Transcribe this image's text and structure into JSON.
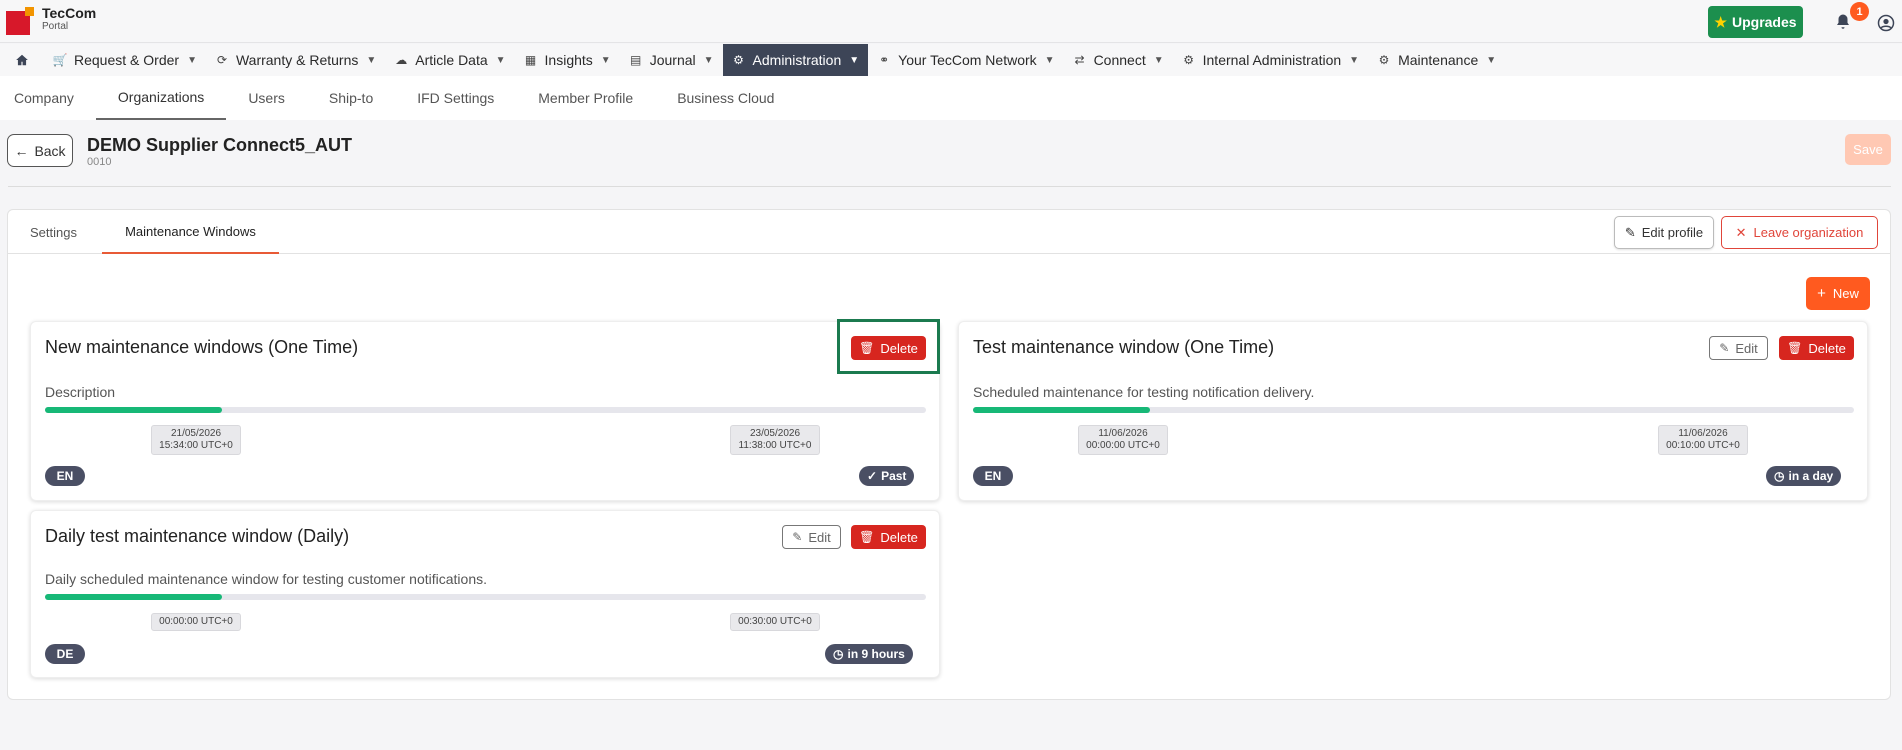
{
  "app": {
    "logo_title": "TecCom",
    "logo_subtitle": "Portal",
    "upgrades_label": "Upgrades",
    "notification_count": "1"
  },
  "colors": {
    "brand_red": "#d7182a",
    "brand_orange": "#f29400",
    "accent": "#ff5a1f",
    "active_nav": "#3d4557",
    "upgrades_green": "#1c8f4e",
    "danger": "#d7261f",
    "progress": "#17b877"
  },
  "main_nav": [
    {
      "label": "Request & Order",
      "icon": "cart-icon"
    },
    {
      "label": "Warranty & Returns",
      "icon": "refresh-icon"
    },
    {
      "label": "Article Data",
      "icon": "cloud-icon"
    },
    {
      "label": "Insights",
      "icon": "chart-icon"
    },
    {
      "label": "Journal",
      "icon": "table-icon"
    },
    {
      "label": "Administration",
      "icon": "gear-icon",
      "active": true
    },
    {
      "label": "Your TecCom Network",
      "icon": "link-icon"
    },
    {
      "label": "Connect",
      "icon": "swap-icon"
    },
    {
      "label": "Internal Administration",
      "icon": "gears-icon"
    },
    {
      "label": "Maintenance",
      "icon": "gears-icon"
    }
  ],
  "sub_nav": [
    {
      "label": "Company"
    },
    {
      "label": "Organizations",
      "active": true
    },
    {
      "label": "Users"
    },
    {
      "label": "Ship-to"
    },
    {
      "label": "IFD Settings"
    },
    {
      "label": "Member Profile"
    },
    {
      "label": "Business Cloud"
    }
  ],
  "header": {
    "back_label": "Back",
    "title": "DEMO Supplier Connect5_AUT",
    "subtitle": "0010",
    "save_label": "Save"
  },
  "panel": {
    "tabs": [
      "Settings",
      "Maintenance Windows"
    ],
    "active_tab": "Maintenance Windows",
    "edit_profile_label": "Edit profile",
    "leave_label": "Leave organization",
    "new_label": "New"
  },
  "buttons": {
    "edit": "Edit",
    "delete": "Delete"
  },
  "cards": [
    {
      "title": "New maintenance windows (One Time)",
      "description": "Description",
      "progress": 0.2,
      "start": [
        "21/05/2026",
        "15:34:00 UTC+0"
      ],
      "end": [
        "23/05/2026",
        "11:38:00 UTC+0"
      ],
      "language": "EN",
      "status": "Past",
      "status_icon": "check-circle-icon",
      "editable": false
    },
    {
      "title": "Test maintenance window (One Time)",
      "description": "Scheduled maintenance for testing notification delivery.",
      "progress": 0.2,
      "start": [
        "11/06/2026",
        "00:00:00 UTC+0"
      ],
      "end": [
        "11/06/2026",
        "00:10:00 UTC+0"
      ],
      "language": "EN",
      "status": "in a day",
      "status_icon": "clock-icon",
      "editable": true
    },
    {
      "title": "Daily test maintenance window (Daily)",
      "description": "Daily scheduled maintenance window for testing customer notifications.",
      "progress": 0.2,
      "start": [
        "00:00:00 UTC+0"
      ],
      "end": [
        "00:30:00 UTC+0"
      ],
      "language": "DE",
      "status": "in 9 hours",
      "status_icon": "clock-icon",
      "editable": true
    }
  ]
}
